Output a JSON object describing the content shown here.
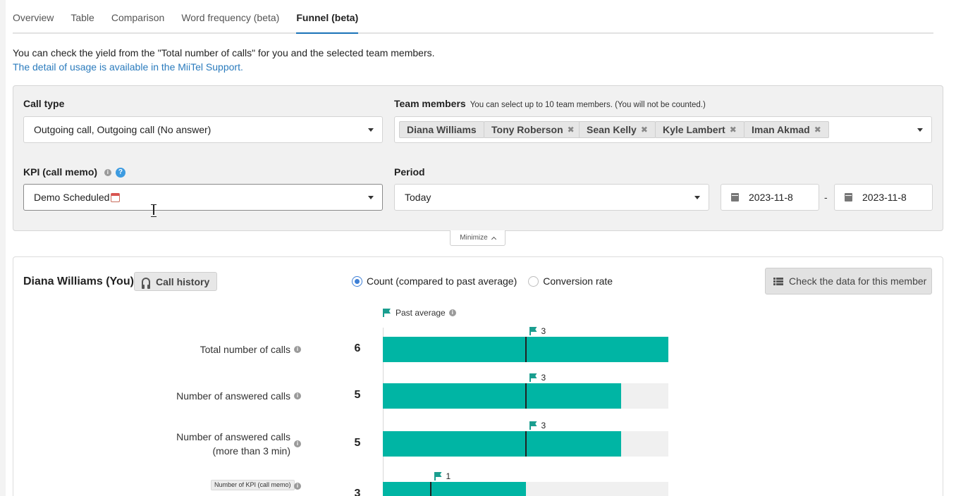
{
  "tabs": [
    {
      "label": "Overview",
      "active": false
    },
    {
      "label": "Table",
      "active": false
    },
    {
      "label": "Comparison",
      "active": false
    },
    {
      "label": "Word frequency (beta)",
      "active": false
    },
    {
      "label": "Funnel (beta)",
      "active": true
    }
  ],
  "intro": {
    "description": "You can check the yield from the \"Total number of calls\" for you and the selected team members.",
    "support_link": "The detail of usage is available in the MiiTel Support."
  },
  "filters": {
    "call_type": {
      "label": "Call type",
      "value": "Outgoing call, Outgoing call (No answer)"
    },
    "team_members": {
      "label": "Team members",
      "note": "You can select up to 10 team members. (You will not be counted.)",
      "chips": [
        {
          "name": "Diana Williams",
          "removable": false
        },
        {
          "name": "Tony Roberson",
          "removable": true
        },
        {
          "name": "Sean Kelly",
          "removable": true
        },
        {
          "name": "Kyle Lambert",
          "removable": true
        },
        {
          "name": "Iman Akmad",
          "removable": true
        }
      ]
    },
    "kpi": {
      "label": "KPI (call memo)",
      "info_icon": "i",
      "help_icon": "?",
      "value": "Demo Scheduled"
    },
    "period": {
      "label": "Period",
      "value": "Today",
      "start_date": "2023-11-8",
      "separator": "-",
      "end_date": "2023-11-8"
    },
    "minimize_label": "Minimize"
  },
  "member_card": {
    "name": "Diana Williams (You)",
    "call_history_label": "Call history",
    "view_options": [
      {
        "label": "Count (compared to past average)",
        "selected": true
      },
      {
        "label": "Conversion rate",
        "selected": false
      }
    ],
    "check_data_label": "Check the data for this member",
    "legend_label": "Past average",
    "accent_color": "#00b5a4"
  },
  "chart_data": {
    "type": "bar",
    "orientation": "horizontal",
    "categories": [
      "Total number of calls",
      "Number of answered calls",
      "Number of answered calls (more than 3 min)",
      "Number of KPI (call memo)"
    ],
    "series": [
      {
        "name": "Count",
        "values": [
          6,
          5,
          5,
          3
        ]
      },
      {
        "name": "Past average",
        "values": [
          3,
          3,
          3,
          1
        ]
      }
    ],
    "xlim": [
      0,
      6
    ],
    "value_labels": [
      "6",
      "5",
      "5",
      "3"
    ],
    "average_labels": [
      "3",
      "3",
      "3",
      "1"
    ]
  }
}
